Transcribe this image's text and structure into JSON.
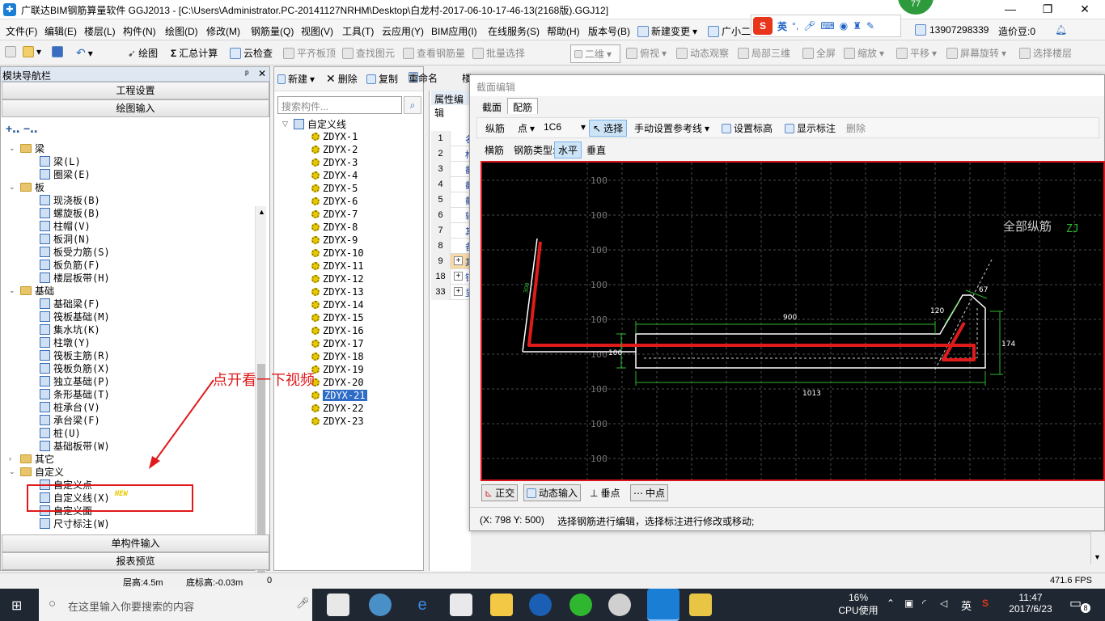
{
  "window": {
    "title": "广联达BIM钢筋算量软件 GGJ2013 - [C:\\Users\\Administrator.PC-20141127NRHM\\Desktop\\白龙村-2017-06-10-17-46-13(2168版).GGJ12]",
    "badge": "77",
    "min": "—",
    "max": "❐",
    "close": "✕"
  },
  "menu": {
    "file": "文件(F)",
    "edit": "编辑(E)",
    "floor": "楼层(L)",
    "component": "构件(N)",
    "draw": "绘图(D)",
    "modify": "修改(M)",
    "rebar_qty": "钢筋量(Q)",
    "view": "视图(V)",
    "tools": "工具(T)",
    "cloud": "云应用(Y)",
    "bim": "BIM应用(I)",
    "online": "在线服务(S)",
    "help": "帮助(H)",
    "version": "版本号(B)",
    "change": "新建变更",
    "assistant": "广小二",
    "phone": "13907298339",
    "beans": "造价豆:0"
  },
  "ime": {
    "logo": "S",
    "lang": "英",
    "punct": "°,"
  },
  "toolbar": {
    "draw": "绘图",
    "summary": "汇总计算",
    "cloud_check": "云检查",
    "flush_slab": "平齐板顶",
    "find_elem": "查找图元",
    "view_rebar": "查看钢筋量",
    "batch_select": "批量选择",
    "dimension": "二维",
    "top_view": "俯视",
    "dynamic": "动态观察",
    "local3d": "局部三维",
    "fullscreen": "全屏",
    "zoom": "缩放",
    "pan": "平移",
    "rotate": "屏幕旋转",
    "select_floor": "选择楼层"
  },
  "left": {
    "header": "模块导航栏",
    "pin": "ᵖ",
    "close": "✕",
    "project_settings": "工程设置",
    "drawing_input": "绘图输入",
    "single_input": "单构件输入",
    "report_preview": "报表预览",
    "tree": [
      {
        "label": "梁",
        "kind": "cat"
      },
      {
        "label": "梁(L)",
        "kind": "item"
      },
      {
        "label": "圈梁(E)",
        "kind": "item"
      },
      {
        "label": "板",
        "kind": "cat"
      },
      {
        "label": "现浇板(B)",
        "kind": "item"
      },
      {
        "label": "螺旋板(B)",
        "kind": "item"
      },
      {
        "label": "柱帽(V)",
        "kind": "item"
      },
      {
        "label": "板洞(N)",
        "kind": "item"
      },
      {
        "label": "板受力筋(S)",
        "kind": "item"
      },
      {
        "label": "板负筋(F)",
        "kind": "item"
      },
      {
        "label": "楼层板带(H)",
        "kind": "item"
      },
      {
        "label": "基础",
        "kind": "cat"
      },
      {
        "label": "基础梁(F)",
        "kind": "item"
      },
      {
        "label": "筏板基础(M)",
        "kind": "item"
      },
      {
        "label": "集水坑(K)",
        "kind": "item"
      },
      {
        "label": "柱墩(Y)",
        "kind": "item"
      },
      {
        "label": "筏板主筋(R)",
        "kind": "item"
      },
      {
        "label": "筏板负筋(X)",
        "kind": "item"
      },
      {
        "label": "独立基础(P)",
        "kind": "item"
      },
      {
        "label": "条形基础(T)",
        "kind": "item"
      },
      {
        "label": "桩承台(V)",
        "kind": "item"
      },
      {
        "label": "承台梁(F)",
        "kind": "item"
      },
      {
        "label": "桩(U)",
        "kind": "item"
      },
      {
        "label": "基础板带(W)",
        "kind": "item"
      },
      {
        "label": "其它",
        "kind": "cat-collapsed"
      },
      {
        "label": "自定义",
        "kind": "cat"
      },
      {
        "label": "自定义点",
        "kind": "item"
      },
      {
        "label": "自定义线(X)",
        "kind": "item",
        "badge": "NEW"
      },
      {
        "label": "自定义面",
        "kind": "item"
      },
      {
        "label": "尺寸标注(W)",
        "kind": "item"
      }
    ]
  },
  "middle": {
    "new": "新建",
    "delete": "删除",
    "copy": "复制",
    "rename": "重命名",
    "more": "楼",
    "search_placeholder": "搜索构件...",
    "root": "自定义线",
    "items": [
      "ZDYX-1",
      "ZDYX-2",
      "ZDYX-3",
      "ZDYX-4",
      "ZDYX-5",
      "ZDYX-6",
      "ZDYX-7",
      "ZDYX-8",
      "ZDYX-9",
      "ZDYX-10",
      "ZDYX-11",
      "ZDYX-12",
      "ZDYX-13",
      "ZDYX-14",
      "ZDYX-15",
      "ZDYX-16",
      "ZDYX-17",
      "ZDYX-18",
      "ZDYX-19",
      "ZDYX-20",
      "ZDYX-21",
      "ZDYX-22",
      "ZDYX-23"
    ],
    "selected": "ZDYX-21"
  },
  "props": {
    "title": "属性编辑",
    "rows": [
      {
        "n": "1",
        "v": "名"
      },
      {
        "n": "2",
        "v": "构"
      },
      {
        "n": "3",
        "v": "截"
      },
      {
        "n": "4",
        "v": "截"
      },
      {
        "n": "5",
        "v": "截"
      },
      {
        "n": "6",
        "v": "轴"
      },
      {
        "n": "7",
        "v": "其"
      },
      {
        "n": "8",
        "v": "备"
      },
      {
        "n": "9",
        "v": "其"
      },
      {
        "n": "18",
        "v": "锚"
      },
      {
        "n": "33",
        "v": "显"
      }
    ]
  },
  "dialog": {
    "title": "截面编辑",
    "tab_section": "截面",
    "tab_rebar": "配筋",
    "longitudinal": "纵筋",
    "point": "点",
    "bar_spec": "1C6",
    "select": "选择",
    "manual_ref": "手动设置参考线",
    "set_elev": "设置标高",
    "show_label": "显示标注",
    "delete": "删除",
    "transverse": "横筋",
    "bar_type_label": "钢筋类型:",
    "horizontal": "水平",
    "vertical": "垂直",
    "ortho": "正交",
    "dyn_input": "动态输入",
    "perp": "垂点",
    "mid": "中点",
    "coords": "(X: 798 Y: 500)",
    "hint": "选择钢筋进行编辑，选择标注进行修改或移动;"
  },
  "canvas": {
    "all_long_bars": "全部纵筋",
    "zj": "ZJ",
    "grid_labels": [
      "100",
      "100",
      "100",
      "100",
      "100",
      "100",
      "100",
      "100",
      "100",
      "100"
    ],
    "dim_900": "900",
    "dim_120": "120",
    "dim_67": "67",
    "dim_174": "174",
    "dim_100": "100",
    "dim_1013": "1013",
    "dim_left": "300"
  },
  "status": {
    "floor_height": "层高:4.5m",
    "floor_bottom": "底标高:-0.03m",
    "zero": "0",
    "fps": "471.6 FPS"
  },
  "taskbar": {
    "search_placeholder": "在这里输入你要搜索的内容",
    "cpu_pct": "16%",
    "cpu_label": "CPU使用",
    "lang": "英",
    "time": "11:47",
    "date": "2017/6/23",
    "notif": "8"
  },
  "annotation": {
    "text": "点开看一下视频"
  },
  "colors": {
    "accent": "#1a7fd4",
    "red_annotation": "#e0191b",
    "canvas_bg": "#000000",
    "rebar_red": "#e01b1b",
    "dim_green": "#2fb82f"
  }
}
